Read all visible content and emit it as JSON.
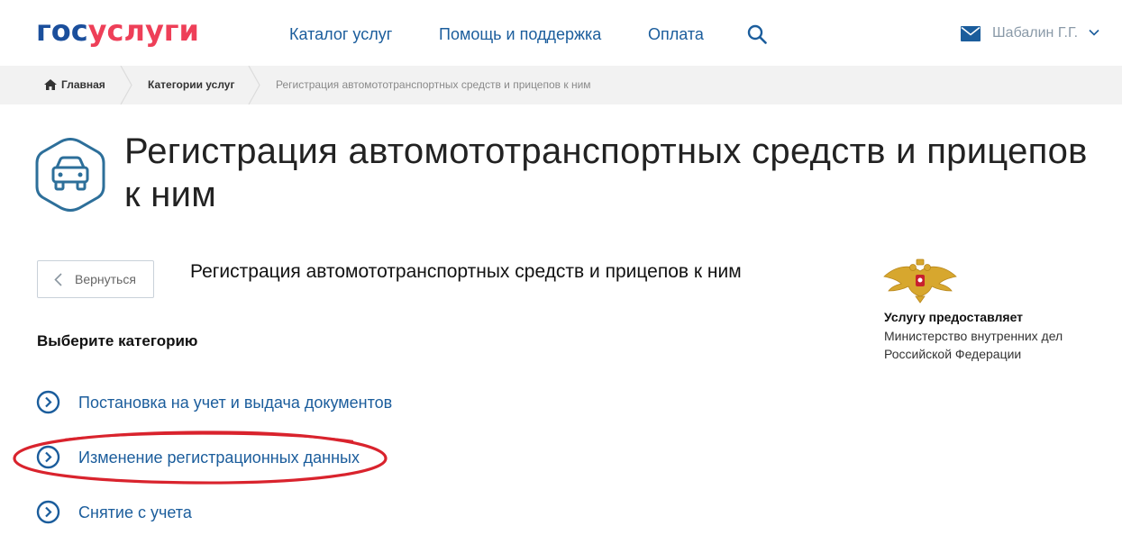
{
  "header": {
    "logo_part1": "гос",
    "logo_part2": "услуги",
    "nav": [
      "Каталог услуг",
      "Помощь и поддержка",
      "Оплата"
    ],
    "user_name": "Шабалин Г.Г."
  },
  "breadcrumb": {
    "home": "Главная",
    "categories": "Категории услуг",
    "current": "Регистрация автомототранспортных средств и прицепов к ним"
  },
  "main": {
    "title": "Регистрация автомототранспортных средств и прицепов к ним",
    "back_label": "Вернуться",
    "subtitle": "Регистрация автомототранспортных средств и прицепов к ним",
    "section_heading": "Выберите категорию",
    "categories": [
      "Постановка на учет и выдача документов",
      "Изменение регистрационных данных",
      "Снятие с учета"
    ]
  },
  "provider": {
    "label": "Услугу предоставляет",
    "name": "Министерство внутренних дел Российской Федерации"
  },
  "colors": {
    "brand_blue": "#1b4f9c",
    "brand_red": "#ee3f58",
    "link": "#1b5d9c",
    "highlight": "#d9232d"
  }
}
